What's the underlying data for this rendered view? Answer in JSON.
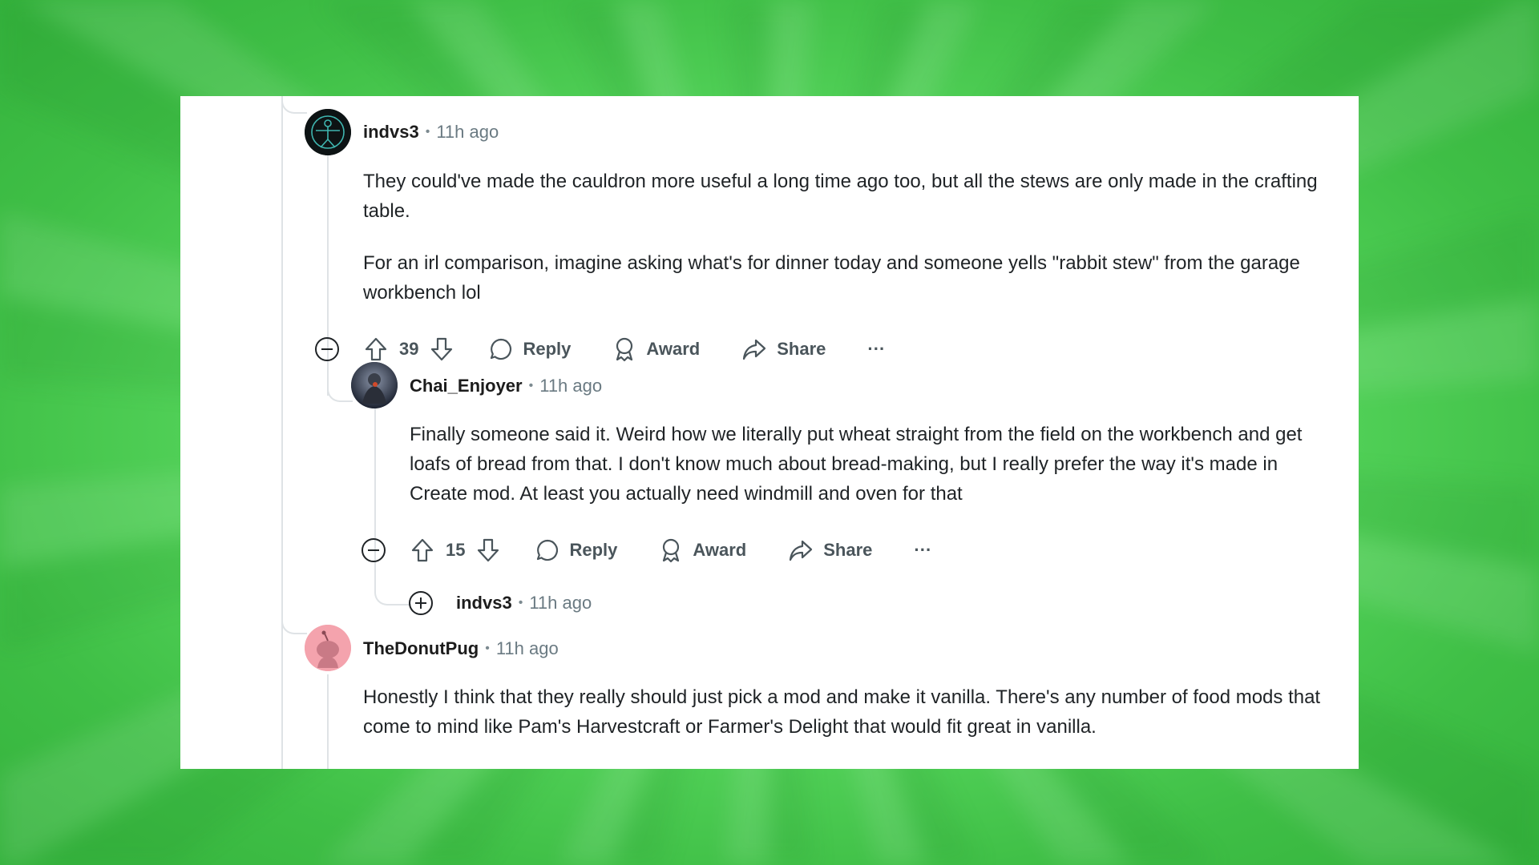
{
  "comments": [
    {
      "username": "indvs3",
      "separator": "•",
      "time": "11h ago",
      "paragraphs": [
        "They could've made the cauldron more useful a long time ago too, but all the stews are only made in the crafting table.",
        "For an irl comparison, imagine asking what's for dinner today and someone yells \"rabbit stew\" from the garage workbench lol"
      ],
      "votes": "39",
      "reply_label": "Reply",
      "award_label": "Award",
      "share_label": "Share",
      "more_label": "···"
    },
    {
      "username": "Chai_Enjoyer",
      "separator": "•",
      "time": "11h ago",
      "paragraphs": [
        "Finally someone said it. Weird how we literally put wheat straight from the field on the workbench and get loafs of bread from that. I don't know much about bread-making, but I really prefer the way it's made in Create mod. At least you actually need windmill and oven for that"
      ],
      "votes": "15",
      "reply_label": "Reply",
      "award_label": "Award",
      "share_label": "Share",
      "more_label": "···"
    },
    {
      "username": "indvs3",
      "separator": "•",
      "time": "11h ago",
      "collapsed": true
    },
    {
      "username": "TheDonutPug",
      "separator": "•",
      "time": "11h ago",
      "paragraphs": [
        "Honestly I think that they really should just pick a mod and make it vanilla. There's any number of food mods that come to mind like Pam's Harvestcraft or Farmer's Delight that would fit great in vanilla."
      ]
    }
  ],
  "colors": {
    "text": "#1f2326",
    "meta": "#6a7a82",
    "action": "#4a555b",
    "thread_line": "#dfe3e6",
    "donut_avatar_bg": "#f4a3ad"
  },
  "icons": [
    "collapse-icon",
    "expand-icon",
    "upvote-icon",
    "downvote-icon",
    "comment-icon",
    "award-icon",
    "share-icon",
    "more-icon"
  ]
}
